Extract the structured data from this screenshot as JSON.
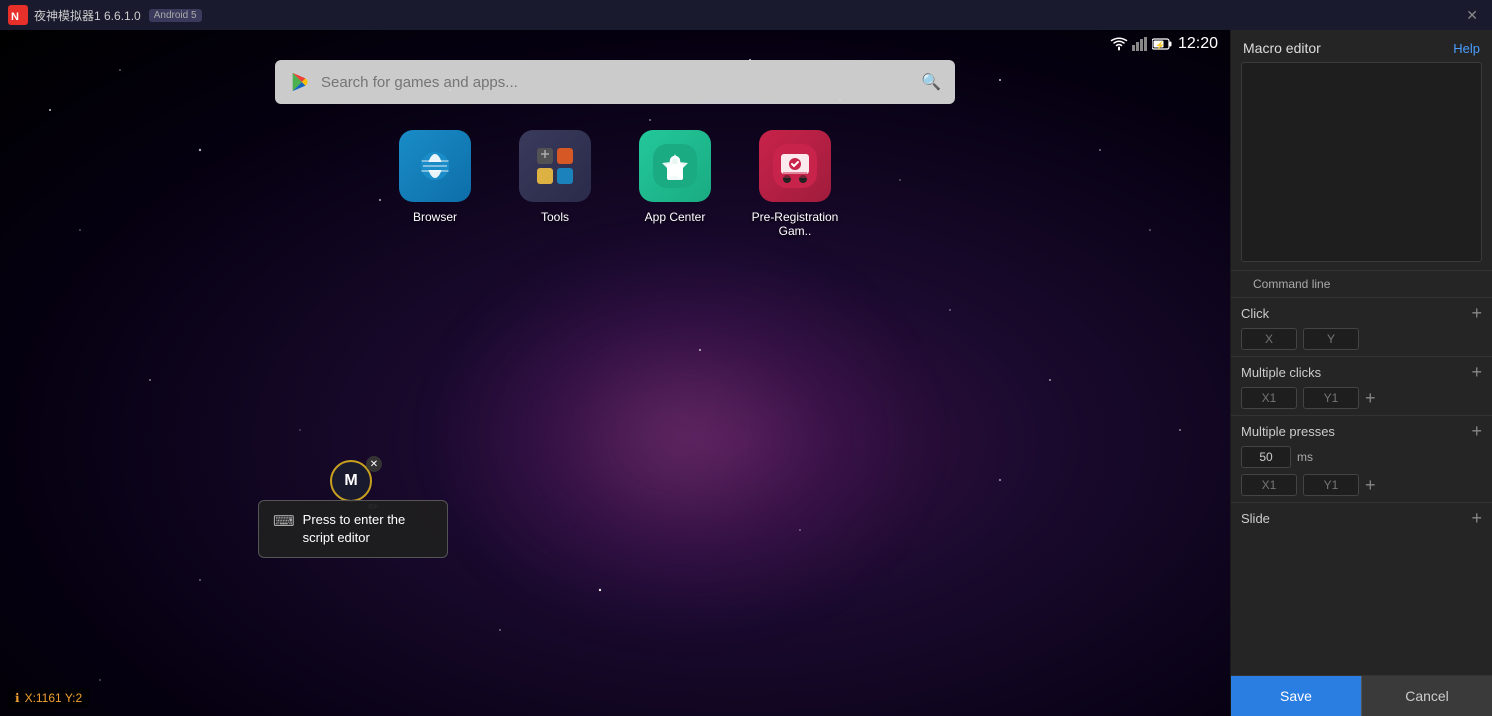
{
  "titlebar": {
    "app_name": "夜神模拟器1 6.6.1.0",
    "android_version": "Android 5",
    "close_label": "✕"
  },
  "status_bar": {
    "time": "12:20"
  },
  "search": {
    "placeholder": "Search for games and apps..."
  },
  "apps": [
    {
      "id": "browser",
      "label": "Browser",
      "icon_class": "icon-browser",
      "emoji": "🐦"
    },
    {
      "id": "tools",
      "label": "Tools",
      "icon_class": "icon-tools",
      "emoji": "⚙"
    },
    {
      "id": "appcenter",
      "label": "App Center",
      "icon_class": "icon-appcenter",
      "emoji": "🛍"
    },
    {
      "id": "prereg",
      "label": "Pre-Registration Gam..",
      "icon_class": "icon-prereg",
      "emoji": "🎮"
    }
  ],
  "tooltip": {
    "text": "Press to enter the script editor"
  },
  "coordinates": {
    "label": "X:1161 Y:2"
  },
  "macro_button": {
    "label": "M"
  },
  "right_panel": {
    "title": "Macro editor",
    "help_label": "Help",
    "command_line_label": "Command line",
    "click_label": "Click",
    "x_label": "X",
    "y_label": "Y",
    "multiple_clicks_label": "Multiple clicks",
    "x1_label": "X1",
    "y1_label": "Y1",
    "multiple_presses_label": "Multiple presses",
    "ms_value": "50",
    "ms_label": "ms",
    "slide_label": "Slide",
    "save_label": "Save",
    "cancel_label": "Cancel"
  }
}
